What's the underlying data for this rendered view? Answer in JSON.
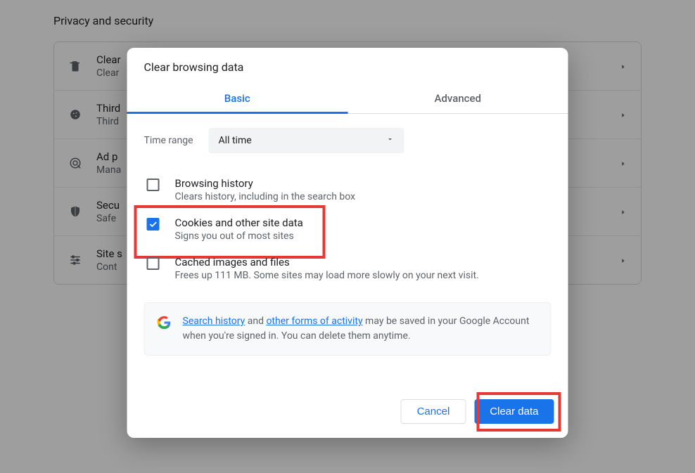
{
  "section_title": "Privacy and security",
  "rows": [
    {
      "title": "Clear",
      "sub": "Clear"
    },
    {
      "title": "Third",
      "sub": "Third"
    },
    {
      "title": "Ad p",
      "sub": "Mana"
    },
    {
      "title": "Secu",
      "sub": "Safe"
    },
    {
      "title": "Site s",
      "sub": "Cont"
    }
  ],
  "dialog": {
    "title": "Clear browsing data",
    "tabs": {
      "basic": "Basic",
      "advanced": "Advanced"
    },
    "time_range_label": "Time range",
    "time_range_value": "All time",
    "items": [
      {
        "title": "Browsing history",
        "sub": "Clears history, including in the search box",
        "checked": false
      },
      {
        "title": "Cookies and other site data",
        "sub": "Signs you out of most sites",
        "checked": true
      },
      {
        "title": "Cached images and files",
        "sub": "Frees up 111 MB. Some sites may load more slowly on your next visit.",
        "checked": false
      }
    ],
    "info": {
      "link1": "Search history",
      "mid": " and ",
      "link2": "other forms of activity",
      "tail": " may be saved in your Google Account when you're signed in. You can delete them anytime."
    },
    "cancel": "Cancel",
    "confirm": "Clear data"
  }
}
